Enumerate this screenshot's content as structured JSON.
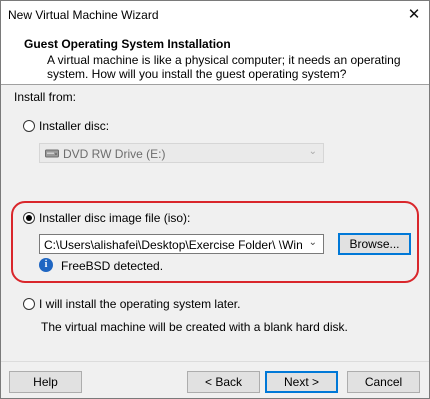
{
  "window": {
    "title": "New Virtual Machine Wizard",
    "close_glyph": "✕"
  },
  "header": {
    "title": "Guest Operating System Installation",
    "description": "A virtual machine is like a physical computer; it needs an operating system. How will you install the guest operating system?"
  },
  "install_from": {
    "label": "Install from:",
    "installer_disc": {
      "label": "Installer disc:",
      "selected": false,
      "drive": "DVD RW Drive (E:)"
    },
    "iso": {
      "label": "Installer disc image file (iso):",
      "selected": true,
      "path": "C:\\Users\\alishafei\\Desktop\\Exercise Folder\\ \\Windows",
      "browse_label": "Browse...",
      "detected": "FreeBSD detected."
    },
    "later": {
      "label": "I will install the operating system later.",
      "selected": false,
      "note": "The virtual machine will be created with a blank hard disk."
    }
  },
  "footer": {
    "help": "Help",
    "back": "< Back",
    "next": "Next >",
    "cancel": "Cancel"
  },
  "colors": {
    "highlight": "#d9262b",
    "info": "#1f66c2",
    "primary_border": "#0078d7"
  },
  "icons": [
    "close-icon",
    "disc-drive-icon",
    "chevron-down-icon",
    "info-icon"
  ]
}
